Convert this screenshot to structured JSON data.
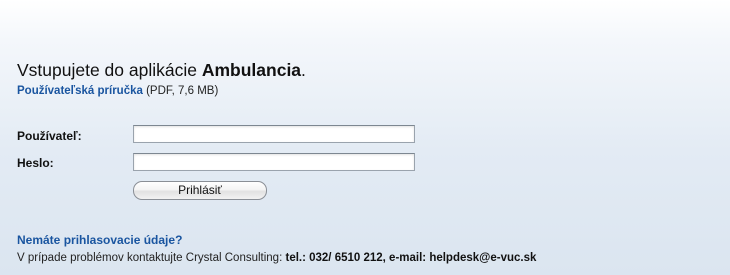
{
  "header": {
    "welcome_prefix": "Vstupujete do aplikácie ",
    "app_name": "Ambulancia",
    "welcome_suffix": "."
  },
  "manual": {
    "link_text": "Používateľská príručka",
    "info": " (PDF, 7,6 MB)"
  },
  "form": {
    "user_label": "Používateľ:",
    "user_value": "",
    "password_label": "Heslo:",
    "password_value": "",
    "login_button": "Prihlásiť"
  },
  "help": {
    "title": "Nemáte prihlasovacie údaje?",
    "contact_prefix": "V prípade problémov kontaktujte Crystal Consulting: ",
    "contact_details": "tel.: 032/ 6510 212, e-mail: helpdesk@e-vuc.sk"
  },
  "colors": {
    "link": "#1a55a0",
    "background_top": "#ffffff",
    "background_bottom": "#dbe5f0"
  }
}
